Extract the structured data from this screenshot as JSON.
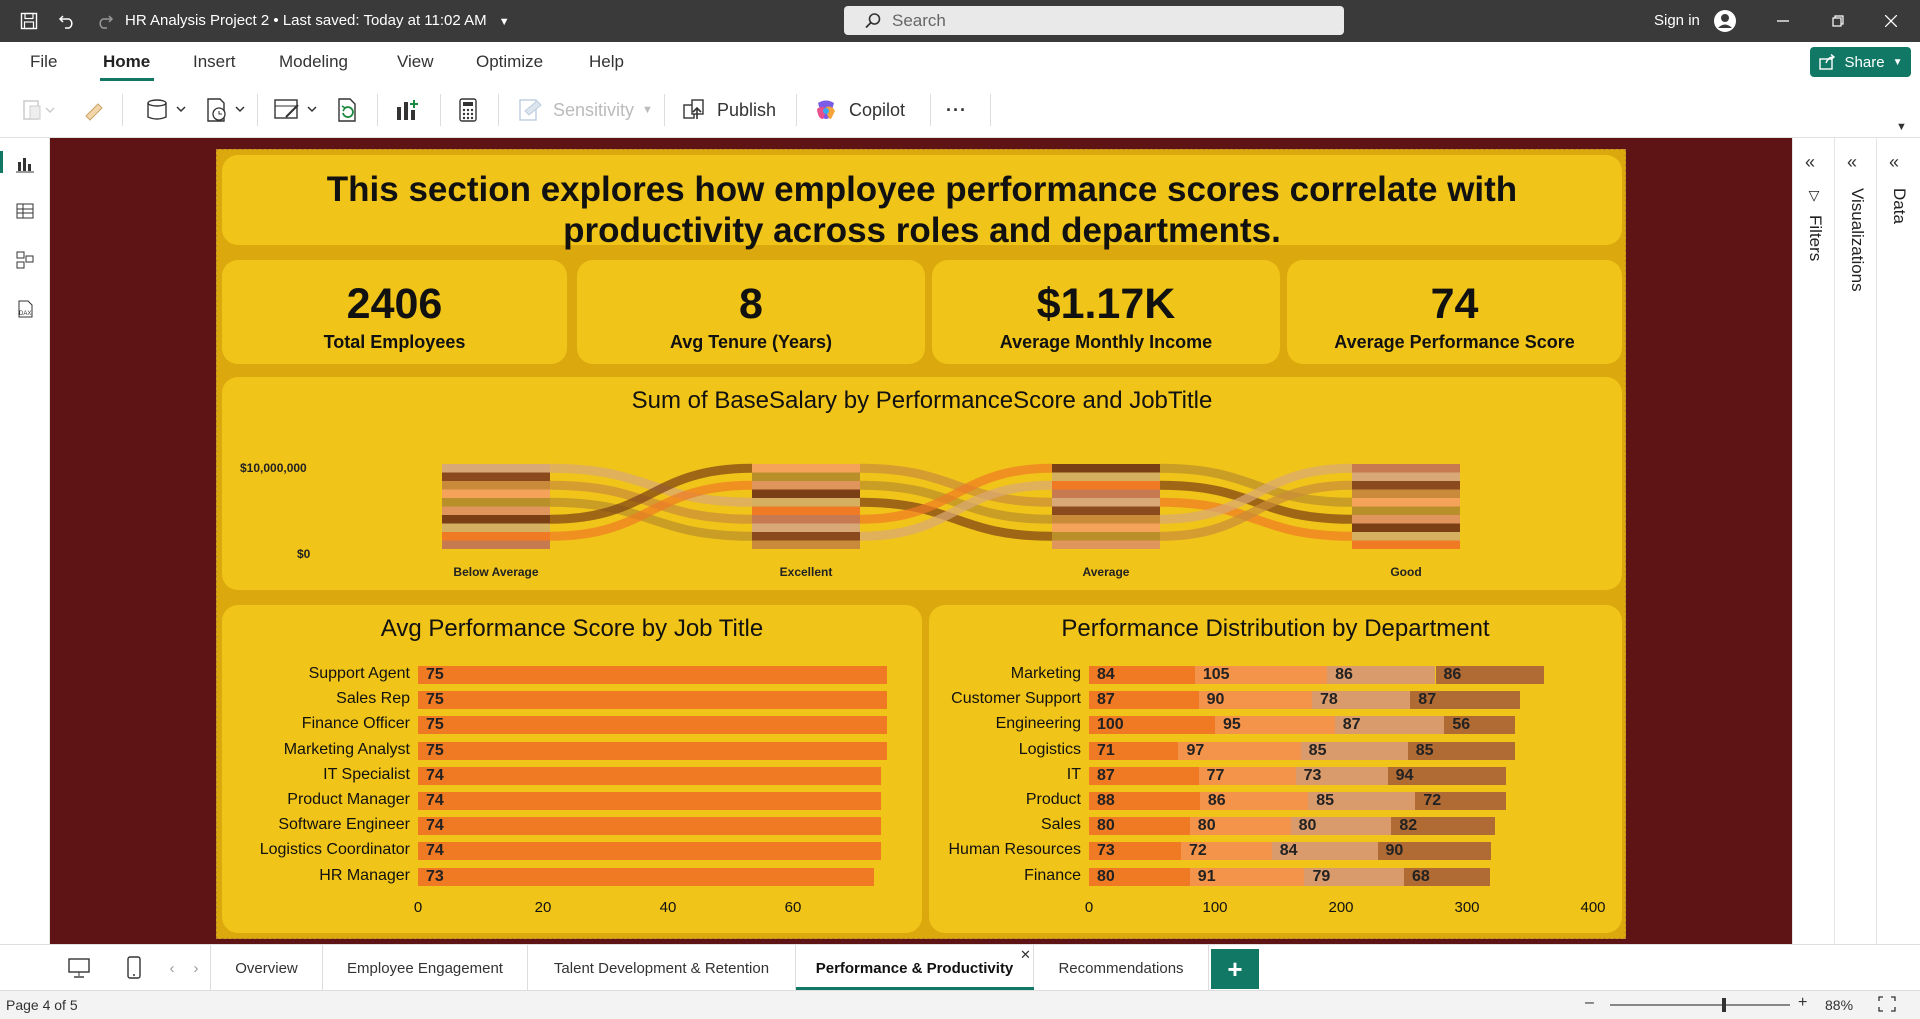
{
  "titlebar": {
    "doc_title": "HR Analysis Project 2",
    "saved": "Last saved: Today at 11:02 AM",
    "search_placeholder": "Search",
    "signin": "Sign in"
  },
  "menu": {
    "items": [
      "File",
      "Home",
      "Insert",
      "Modeling",
      "View",
      "Optimize",
      "Help"
    ],
    "active": "Home",
    "share": "Share"
  },
  "ribbon": {
    "sensitivity": "Sensitivity",
    "publish": "Publish",
    "copilot": "Copilot",
    "more": "···"
  },
  "report": {
    "header": "This section explores how employee performance scores correlate with productivity across roles and departments.",
    "kpis": [
      {
        "value": "2406",
        "label": "Total Employees"
      },
      {
        "value": "8",
        "label": "Avg Tenure (Years)"
      },
      {
        "value": "$1.17K",
        "label": "Average Monthly Income"
      },
      {
        "value": "74",
        "label": "Average Performance Score"
      }
    ]
  },
  "chart_data": [
    {
      "type": "area",
      "title": "Sum of BaseSalary by PerformanceScore and JobTitle",
      "categories": [
        "Below Average",
        "Excellent",
        "Average",
        "Good"
      ],
      "y_ticks": [
        "$10,000,000",
        "$0"
      ]
    },
    {
      "type": "bar",
      "orientation": "horizontal",
      "title": "Avg Performance Score by Job Title",
      "categories": [
        "Support Agent",
        "Sales Rep",
        "Finance Officer",
        "Marketing Analyst",
        "IT Specialist",
        "Product Manager",
        "Software Engineer",
        "Logistics Coordinator",
        "HR Manager"
      ],
      "values": [
        75,
        75,
        75,
        75,
        74,
        74,
        74,
        74,
        73
      ],
      "x_ticks": [
        "0",
        "20",
        "40",
        "60"
      ],
      "xlim": [
        0,
        80
      ]
    },
    {
      "type": "bar",
      "orientation": "horizontal",
      "stacked": true,
      "title": "Performance Distribution by Department",
      "categories": [
        "Marketing",
        "Customer Support",
        "Engineering",
        "Logistics",
        "IT",
        "Product",
        "Sales",
        "Human Resources",
        "Finance"
      ],
      "series": [
        {
          "values": [
            84,
            87,
            100,
            71,
            87,
            88,
            80,
            73,
            80
          ],
          "color": "#f07a24"
        },
        {
          "values": [
            105,
            90,
            95,
            97,
            77,
            86,
            80,
            72,
            91
          ],
          "color": "#f4944a"
        },
        {
          "values": [
            86,
            78,
            87,
            85,
            73,
            85,
            80,
            84,
            79
          ],
          "color": "#d99a6c"
        },
        {
          "values": [
            86,
            87,
            56,
            85,
            94,
            72,
            82,
            90,
            68
          ],
          "color": "#b06a34"
        }
      ],
      "x_ticks": [
        "0",
        "100",
        "200",
        "300",
        "400"
      ],
      "xlim": [
        0,
        400
      ]
    }
  ],
  "tabs": {
    "items": [
      "Overview",
      "Employee Engagement",
      "Talent Development & Retention",
      "Performance & Productivity",
      "Recommendations"
    ],
    "active": "Performance & Productivity",
    "add": "+"
  },
  "panes": [
    "Filters",
    "Visualizations",
    "Data"
  ],
  "status": {
    "page": "Page 4 of 5",
    "zoom": "88%"
  },
  "colors": {
    "canvas": "#5e1414",
    "card": "#f0c419",
    "bar": "#f07a24",
    "accent": "#117865"
  }
}
